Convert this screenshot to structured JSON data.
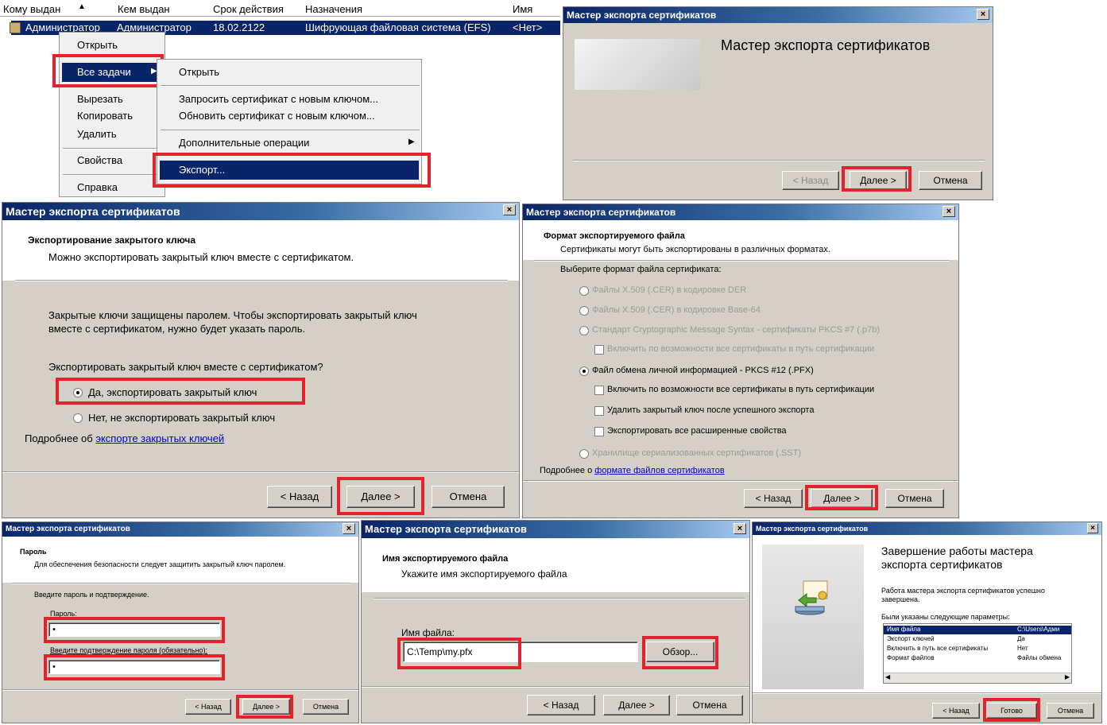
{
  "list": {
    "columns": [
      "Кому выдан",
      "Кем выдан",
      "Срок действия",
      "Назначения",
      "Имя"
    ],
    "row": [
      "Администратор",
      "Администратор",
      "18.02.2122",
      "Шифрующая файловая система (EFS)",
      "<Нет>"
    ]
  },
  "context_menu": {
    "items": [
      "Открыть",
      "Все задачи",
      "Вырезать",
      "Копировать",
      "Удалить",
      "Свойства",
      "Справка"
    ]
  },
  "submenu": {
    "items": [
      "Открыть",
      "Запросить сертификат с новым ключом...",
      "Обновить сертификат с новым ключом...",
      "Дополнительные операции",
      "Экспорт..."
    ]
  },
  "wizard_title": "Мастер экспорта сертификатов",
  "welcome": {
    "heading": "Мастер экспорта сертификатов",
    "back": "< Назад",
    "next": "Далее >",
    "cancel": "Отмена"
  },
  "private_key": {
    "heading": "Экспортирование закрытого ключа",
    "subheading": "Можно экспортировать закрытый ключ вместе с сертификатом.",
    "body1": "Закрытые ключи защищены паролем. Чтобы экспортировать закрытый ключ",
    "body2": "вместе с сертификатом, нужно будет указать пароль.",
    "question": "Экспортировать закрытый ключ вместе с сертификатом?",
    "yes": "Да, экспортировать закрытый ключ",
    "no": "Нет, не экспортировать закрытый ключ",
    "more_prefix": "Подробнее об",
    "more_link": "экспорте закрытых ключей",
    "back": "< Назад",
    "next": "Далее >",
    "cancel": "Отмена"
  },
  "format": {
    "heading": "Формат экспортируемого файла",
    "subheading": "Сертификаты могут быть экспортированы в различных форматах.",
    "prompt": "Выберите формат файла сертификата:",
    "opt_der": "Файлы X.509 (.CER) в кодировке DER",
    "opt_b64": "Файлы X.509 (.CER) в кодировке Base-64",
    "opt_p7b": "Стандарт Cryptographic Message Syntax - сертификаты PKCS #7 (.p7b)",
    "chk_p7b_path": "Включить по возможности все сертификаты в путь сертификации",
    "opt_pfx": "Файл обмена личной информацией - PKCS #12 (.PFX)",
    "chk_path": "Включить по возможности все сертификаты в путь сертификации",
    "chk_delete": "Удалить закрытый ключ после успешного экспорта",
    "chk_ext": "Экспортировать все расширенные свойства",
    "opt_sst": "Хранилище сериализованных сертификатов (.SST)",
    "more_prefix": "Подробнее о",
    "more_link": "формате файлов сертификатов",
    "back": "< Назад",
    "next": "Далее >",
    "cancel": "Отмена"
  },
  "password": {
    "heading": "Пароль",
    "subheading": "Для обеспечения безопасности следует защитить закрытый ключ паролем.",
    "prompt": "Введите пароль и подтверждение.",
    "pwd_label": "Пароль:",
    "pwd_value": "•",
    "confirm_label": "Введите подтверждение пароля (обязательно):",
    "confirm_value": "•",
    "back": "< Назад",
    "next": "Далее >",
    "cancel": "Отмена"
  },
  "filename": {
    "heading": "Имя экспортируемого файла",
    "subheading": "Укажите имя экспортируемого файла",
    "label": "Имя файла:",
    "value": "C:\\Temp\\my.pfx",
    "browse": "Обзор...",
    "back": "< Назад",
    "next": "Далее >",
    "cancel": "Отмена"
  },
  "finish": {
    "heading1": "Завершение работы мастера",
    "heading2": "экспорта сертификатов",
    "done1": "Работа мастера экспорта сертификатов успешно",
    "done2": "завершена.",
    "params_label": "Были указаны следующие параметры:",
    "params": [
      [
        "Имя файла",
        "C:\\Users\\Адми"
      ],
      [
        "Экспорт ключей",
        "Да"
      ],
      [
        "Включить в путь все сертификаты",
        "Нет"
      ],
      [
        "Формат файлов",
        "Файлы обмена"
      ]
    ],
    "back": "< Назад",
    "finish": "Готово",
    "cancel": "Отмена"
  }
}
